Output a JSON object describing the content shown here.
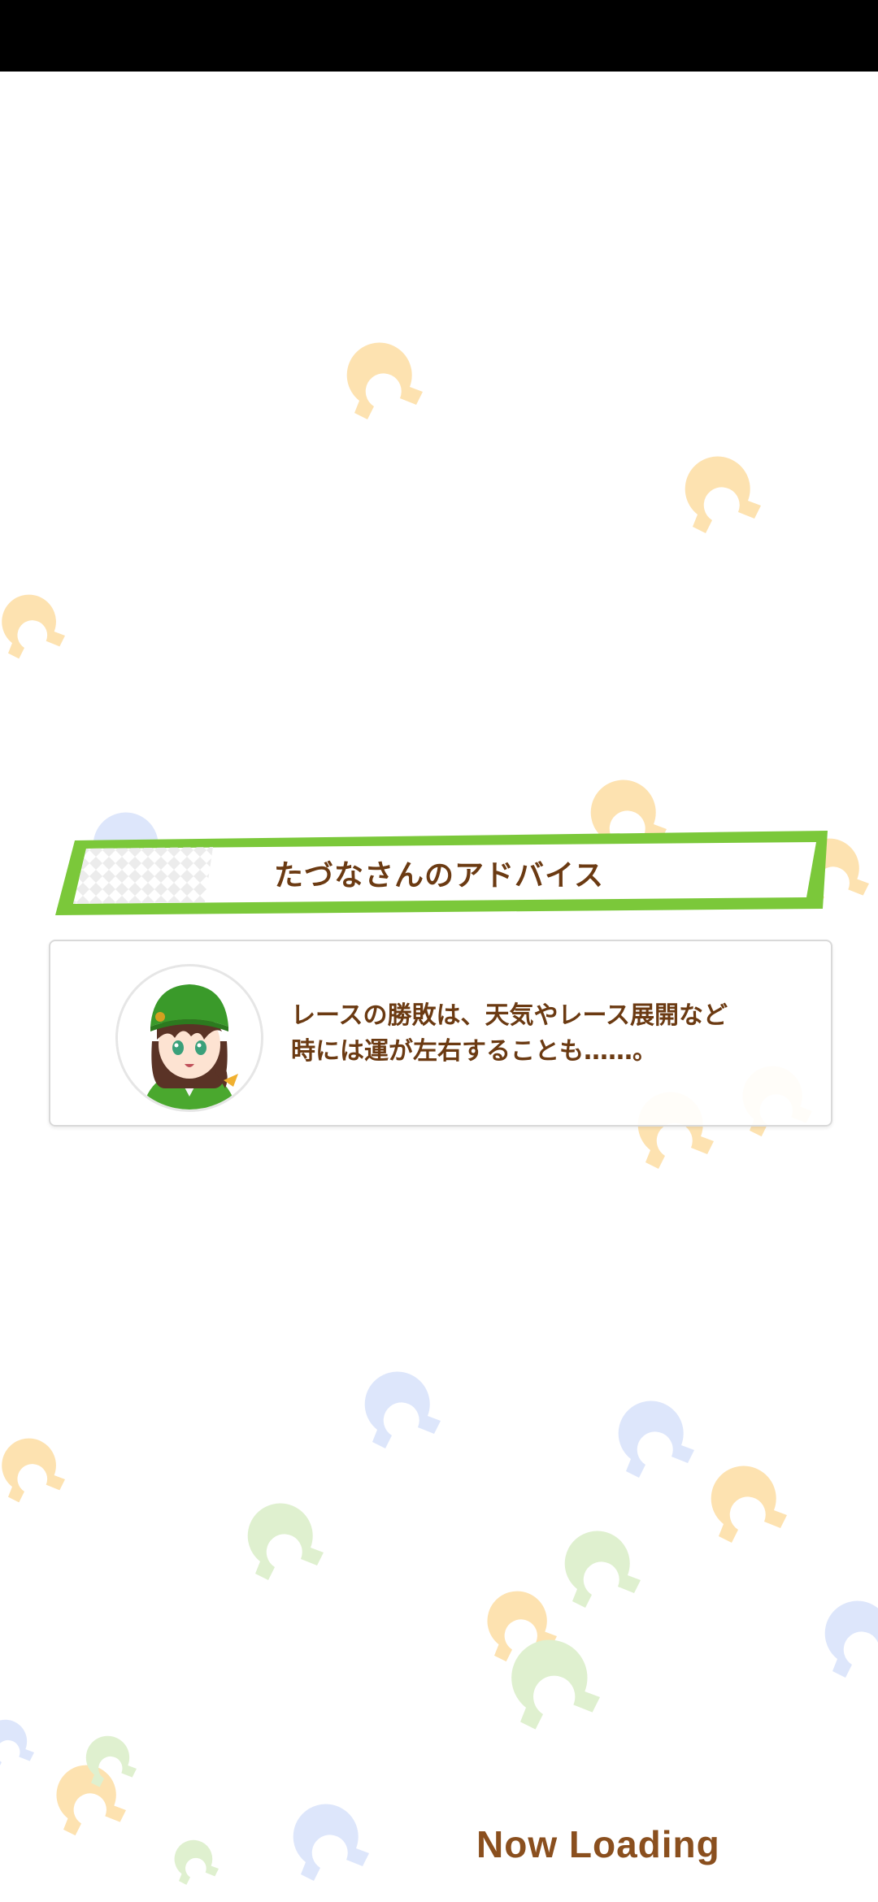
{
  "advice": {
    "title": "たづなさんのアドバイス",
    "line1": "レースの勝敗は、天気やレース展開など",
    "line2": "時には運が左右することも……。",
    "avatar_icon": "character-portrait-tazuna"
  },
  "loading": {
    "label": "Now Loading"
  },
  "decor": {
    "icon": "horseshoe-icon",
    "colors": {
      "orange": "#fde2b0",
      "blue": "#dde6fb",
      "green": "#dff0cf"
    }
  },
  "theme": {
    "accent_green": "#7bc83a",
    "text_brown": "#6b3a12"
  }
}
